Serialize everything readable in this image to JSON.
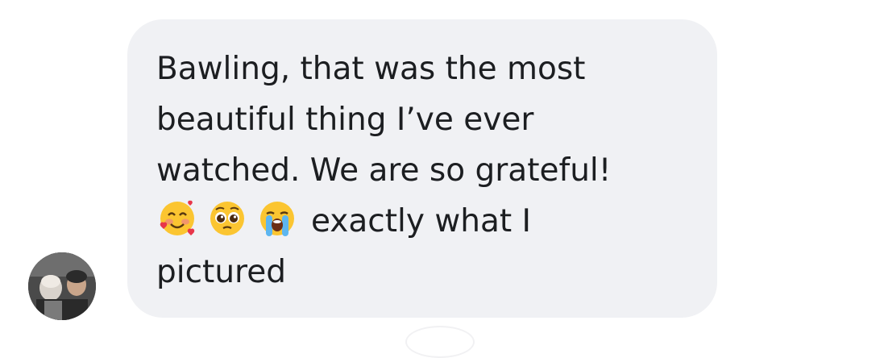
{
  "message": {
    "lines": [
      "Bawling, that was the most",
      "beautiful thing I’ve ever",
      "watched. We are so grateful!",
      "exactly what I",
      "pictured"
    ],
    "emojis": [
      "smiling-face-with-hearts",
      "pleading-face",
      "loudly-crying-face"
    ]
  },
  "colors": {
    "bubble": "#f0f1f4",
    "text": "#1c1e21"
  }
}
